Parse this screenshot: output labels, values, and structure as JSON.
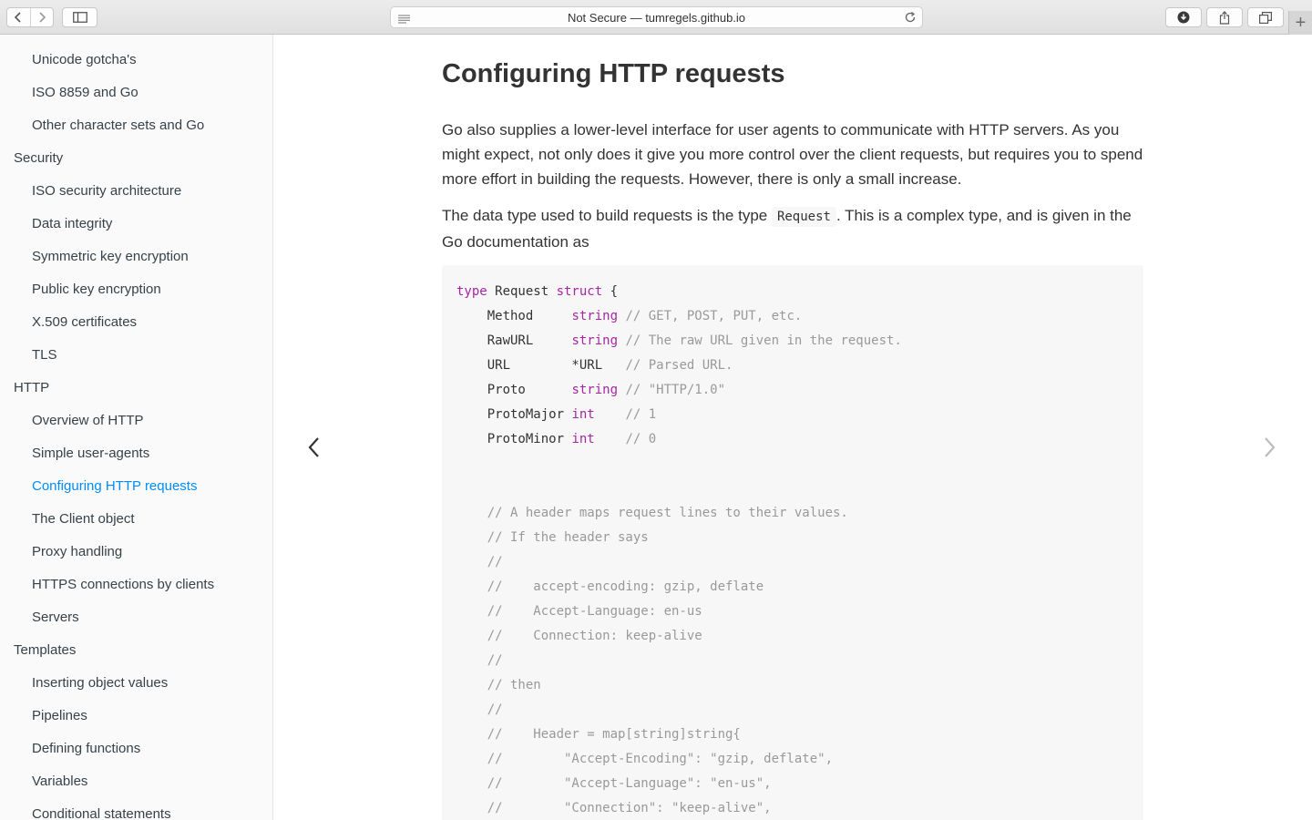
{
  "browser": {
    "address_text": "Not Secure — tumregels.github.io",
    "icons": {
      "back": "chevron-left-icon",
      "forward": "chevron-right-icon",
      "sidebar_toggle": "sidebar-icon",
      "reader": "reader-icon",
      "reload": "reload-icon",
      "download": "download-icon",
      "share": "share-icon",
      "tabs": "tabs-icon",
      "new_tab": "+"
    }
  },
  "sidebar": {
    "items": [
      {
        "label": "Unicode gotcha's",
        "level": "sub"
      },
      {
        "label": "ISO 8859 and Go",
        "level": "sub"
      },
      {
        "label": "Other character sets and Go",
        "level": "sub"
      },
      {
        "label": "Security",
        "level": "top"
      },
      {
        "label": "ISO security architecture",
        "level": "sub"
      },
      {
        "label": "Data integrity",
        "level": "sub"
      },
      {
        "label": "Symmetric key encryption",
        "level": "sub"
      },
      {
        "label": "Public key encryption",
        "level": "sub"
      },
      {
        "label": "X.509 certificates",
        "level": "sub"
      },
      {
        "label": "TLS",
        "level": "sub"
      },
      {
        "label": "HTTP",
        "level": "top"
      },
      {
        "label": "Overview of HTTP",
        "level": "sub"
      },
      {
        "label": "Simple user-agents",
        "level": "sub"
      },
      {
        "label": "Configuring HTTP requests",
        "level": "sub",
        "active": true
      },
      {
        "label": "The Client object",
        "level": "sub"
      },
      {
        "label": "Proxy handling",
        "level": "sub"
      },
      {
        "label": "HTTPS connections by clients",
        "level": "sub"
      },
      {
        "label": "Servers",
        "level": "sub"
      },
      {
        "label": "Templates",
        "level": "top"
      },
      {
        "label": "Inserting object values",
        "level": "sub"
      },
      {
        "label": "Pipelines",
        "level": "sub"
      },
      {
        "label": "Defining functions",
        "level": "sub"
      },
      {
        "label": "Variables",
        "level": "sub"
      },
      {
        "label": "Conditional statements",
        "level": "sub"
      }
    ],
    "active_color": "#008cff"
  },
  "content": {
    "title": "Configuring HTTP requests",
    "para1": "Go also supplies a lower-level interface for user agents to communicate with HTTP servers. As you might expect, not only does it give you more control over the client requests, but requires you to spend more effort in building the requests. However, there is only a small increase.",
    "para2_before": "The data type used to build requests is the type ",
    "para2_code": "Request",
    "para2_after": ". This is a complex type, and is given in the Go documentation as",
    "code_lines": [
      [
        [
          "kw",
          "type"
        ],
        [
          "t",
          " Request "
        ],
        [
          "kw",
          "struct"
        ],
        [
          "t",
          " {"
        ]
      ],
      [
        [
          "t",
          "    Method     "
        ],
        [
          "kw",
          "string"
        ],
        [
          "cm",
          " // GET, POST, PUT, etc."
        ]
      ],
      [
        [
          "t",
          "    RawURL     "
        ],
        [
          "kw",
          "string"
        ],
        [
          "cm",
          " // The raw URL given in the request."
        ]
      ],
      [
        [
          "t",
          "    URL        *URL   "
        ],
        [
          "cm",
          "// Parsed URL."
        ]
      ],
      [
        [
          "t",
          "    Proto      "
        ],
        [
          "kw",
          "string"
        ],
        [
          "cm",
          " // \"HTTP/1.0\""
        ]
      ],
      [
        [
          "t",
          "    ProtoMajor "
        ],
        [
          "kw",
          "int"
        ],
        [
          "cm",
          "    // 1"
        ]
      ],
      [
        [
          "t",
          "    ProtoMinor "
        ],
        [
          "kw",
          "int"
        ],
        [
          "cm",
          "    // 0"
        ]
      ],
      [],
      [],
      [
        [
          "cm",
          "    // A header maps request lines to their values."
        ]
      ],
      [
        [
          "cm",
          "    // If the header says"
        ]
      ],
      [
        [
          "cm",
          "    //"
        ]
      ],
      [
        [
          "cm",
          "    //    accept-encoding: gzip, deflate"
        ]
      ],
      [
        [
          "cm",
          "    //    Accept-Language: en-us"
        ]
      ],
      [
        [
          "cm",
          "    //    Connection: keep-alive"
        ]
      ],
      [
        [
          "cm",
          "    //"
        ]
      ],
      [
        [
          "cm",
          "    // then"
        ]
      ],
      [
        [
          "cm",
          "    //"
        ]
      ],
      [
        [
          "cm",
          "    //    Header = map[string]string{"
        ]
      ],
      [
        [
          "cm",
          "    //        \"Accept-Encoding\": \"gzip, deflate\","
        ]
      ],
      [
        [
          "cm",
          "    //        \"Accept-Language\": \"en-us\","
        ]
      ],
      [
        [
          "cm",
          "    //        \"Connection\": \"keep-alive\","
        ]
      ]
    ]
  },
  "navigation": {
    "prev_icon": "chevron-left-icon",
    "next_icon": "chevron-right-icon"
  }
}
